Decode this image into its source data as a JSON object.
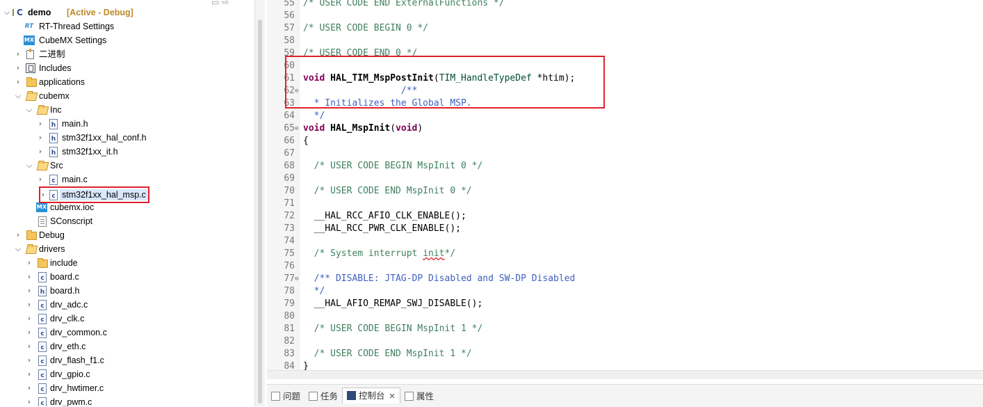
{
  "explorer": {
    "project_name": "demo",
    "project_state": "[Active - Debug]",
    "items": [
      {
        "label": "RT-Thread Settings",
        "icon": "rt-thread-icon"
      },
      {
        "label": "CubeMX Settings",
        "icon": "cubemx-icon"
      },
      {
        "label": "二进制",
        "icon": "binaries-icon"
      },
      {
        "label": "Includes",
        "icon": "includes-icon"
      },
      {
        "label": "applications",
        "icon": "folder-icon"
      },
      {
        "label": "cubemx",
        "icon": "folder-open-icon"
      },
      {
        "label": "Inc",
        "icon": "folder-open-icon"
      },
      {
        "label": "main.h",
        "icon": "h-file-icon"
      },
      {
        "label": "stm32f1xx_hal_conf.h",
        "icon": "h-file-icon"
      },
      {
        "label": "stm32f1xx_it.h",
        "icon": "h-file-icon"
      },
      {
        "label": "Src",
        "icon": "folder-open-icon"
      },
      {
        "label": "main.c",
        "icon": "c-file-icon"
      },
      {
        "label": "stm32f1xx_hal_msp.c",
        "icon": "c-file-icon"
      },
      {
        "label": "cubemx.ioc",
        "icon": "cubemx-icon"
      },
      {
        "label": "SConscript",
        "icon": "script-file-icon"
      },
      {
        "label": "Debug",
        "icon": "folder-icon"
      },
      {
        "label": "drivers",
        "icon": "folder-open-icon"
      },
      {
        "label": "include",
        "icon": "folder-icon"
      },
      {
        "label": "board.c",
        "icon": "c-file-icon"
      },
      {
        "label": "board.h",
        "icon": "h-file-icon"
      },
      {
        "label": "drv_adc.c",
        "icon": "c-file-icon"
      },
      {
        "label": "drv_clk.c",
        "icon": "c-file-icon"
      },
      {
        "label": "drv_common.c",
        "icon": "c-file-icon"
      },
      {
        "label": "drv_eth.c",
        "icon": "c-file-icon"
      },
      {
        "label": "drv_flash_f1.c",
        "icon": "c-file-icon"
      },
      {
        "label": "drv_gpio.c",
        "icon": "c-file-icon"
      },
      {
        "label": "drv_hwtimer.c",
        "icon": "c-file-icon"
      },
      {
        "label": "drv_pwm.c",
        "icon": "c-file-icon"
      }
    ],
    "icon_letters": {
      "h": "h",
      "c": "c",
      "mx": "MX",
      "rt": "RT"
    }
  },
  "editor": {
    "lines": [
      {
        "n": "55",
        "text": "/* USER CODE END ExternalFunctions */"
      },
      {
        "n": "56",
        "text": ""
      },
      {
        "n": "57",
        "text": "/* USER CODE BEGIN 0 */"
      },
      {
        "n": "58",
        "text": ""
      },
      {
        "n": "59",
        "text": "/* USER CODE END 0 */"
      },
      {
        "n": "60",
        "text": ""
      },
      {
        "n": "61",
        "kw": "void",
        "fn": "HAL_TIM_MspPostInit",
        "open": "(",
        "type": "TIM_HandleTypeDef",
        "rest": " *htim);"
      },
      {
        "n": "62",
        "text": "                  /**"
      },
      {
        "n": "63",
        "text": "  * Initializes the Global MSP."
      },
      {
        "n": "64",
        "text": "  */"
      },
      {
        "n": "65",
        "kw": "void",
        "fn": "HAL_MspInit",
        "open": "(",
        "kw2": "void",
        "rest": ")"
      },
      {
        "n": "66",
        "text": "{"
      },
      {
        "n": "67",
        "text": ""
      },
      {
        "n": "68",
        "text": "  /* USER CODE BEGIN MspInit 0 */"
      },
      {
        "n": "69",
        "text": ""
      },
      {
        "n": "70",
        "text": "  /* USER CODE END MspInit 0 */"
      },
      {
        "n": "71",
        "text": ""
      },
      {
        "n": "72",
        "text": "  __HAL_RCC_AFIO_CLK_ENABLE();"
      },
      {
        "n": "73",
        "text": "  __HAL_RCC_PWR_CLK_ENABLE();"
      },
      {
        "n": "74",
        "text": ""
      },
      {
        "n": "75",
        "pre": "  /* System interrupt ",
        "squig": "init",
        "post": "*/"
      },
      {
        "n": "76",
        "text": ""
      },
      {
        "n": "77",
        "text": "  /** DISABLE: JTAG-DP Disabled and SW-DP Disabled"
      },
      {
        "n": "78",
        "text": "  */"
      },
      {
        "n": "79",
        "text": "  __HAL_AFIO_REMAP_SWJ_DISABLE();"
      },
      {
        "n": "80",
        "text": ""
      },
      {
        "n": "81",
        "text": "  /* USER CODE BEGIN MspInit 1 */"
      },
      {
        "n": "82",
        "text": ""
      },
      {
        "n": "83",
        "text": "  /* USER CODE END MspInit 1 */"
      },
      {
        "n": "84",
        "text": "}"
      }
    ]
  },
  "bottom_tabs": [
    {
      "label": "问题",
      "icon": "problems-icon"
    },
    {
      "label": "任务",
      "icon": "tasks-icon"
    },
    {
      "label": "控制台",
      "icon": "console-icon",
      "active": true,
      "close": "✕"
    },
    {
      "label": "属性",
      "icon": "properties-icon"
    }
  ],
  "colors": {
    "highlight": "#e0202a",
    "comment": "#3f7f5f",
    "doc_comment": "#3f5fbf",
    "keyword": "#7f0055"
  }
}
